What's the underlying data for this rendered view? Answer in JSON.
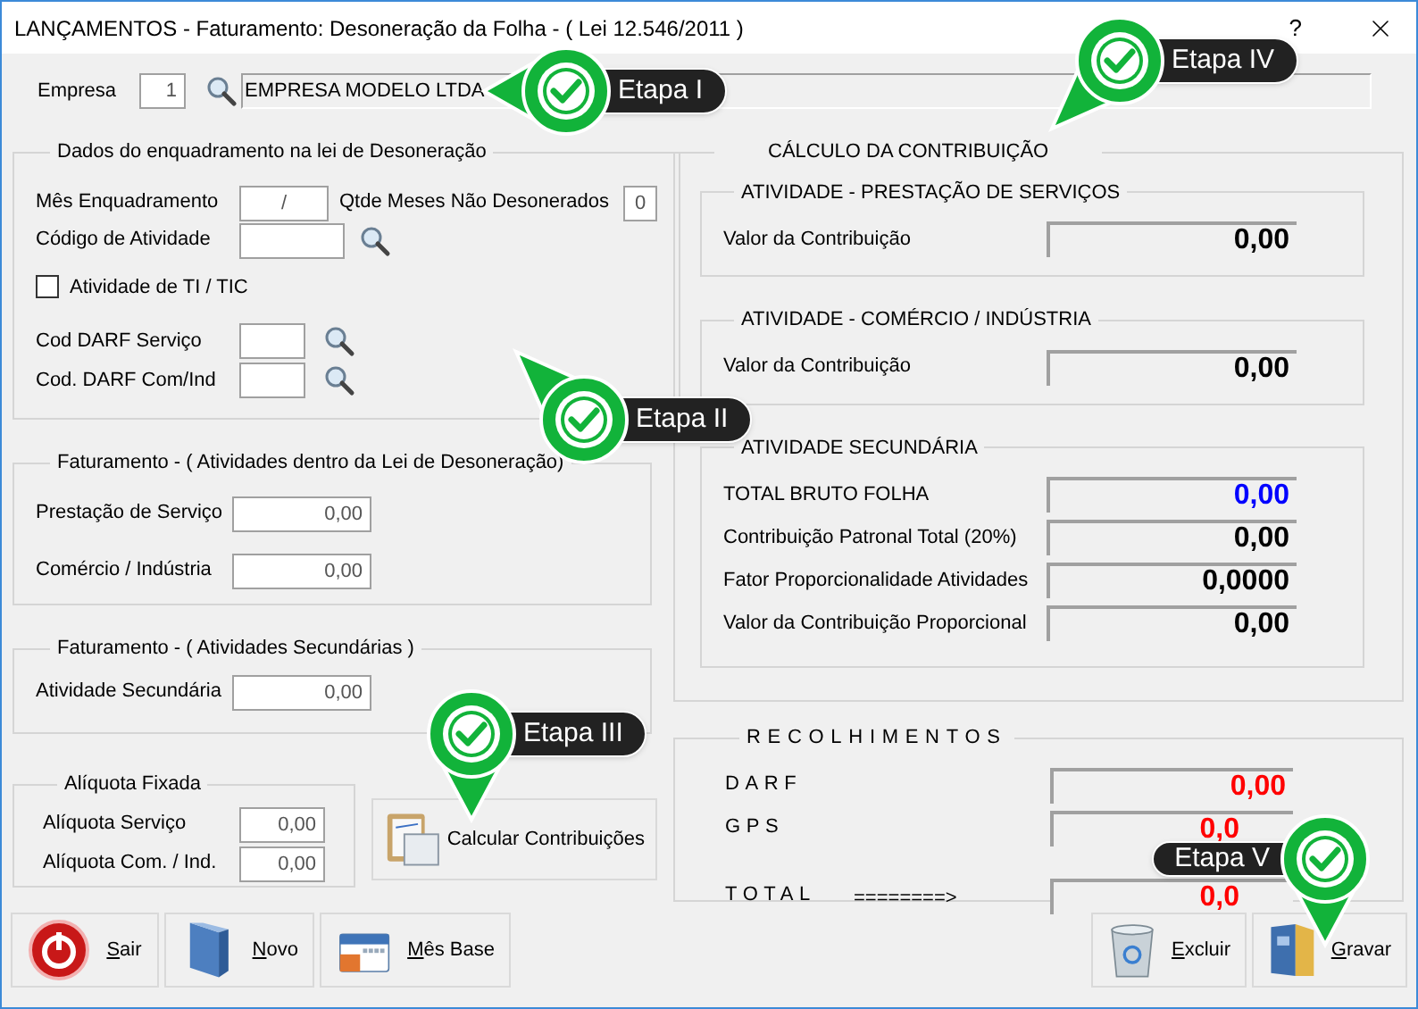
{
  "window": {
    "title": "LANÇAMENTOS - Faturamento: Desoneração da Folha - ( Lei 12.546/2011 )",
    "help": "?"
  },
  "empresa": {
    "label": "Empresa",
    "code": "1",
    "name": "EMPRESA MODELO LTDA"
  },
  "enquadramento": {
    "title": "Dados do enquadramento na lei de Desoneração",
    "mes_label": "Mês Enquadramento",
    "mes_value": "/",
    "qtde_label": "Qtde Meses Não Desonerados",
    "qtde_value": "0",
    "codigo_label": "Código de Atividade",
    "ti": {
      "label": "Atividade de TI / TIC",
      "checked": false
    },
    "darf_servico_label": "Cod DARF Serviço",
    "darf_com_label": "Cod. DARF Com/Ind"
  },
  "faturamento_lei": {
    "title": "Faturamento - ( Atividades dentro da Lei de Desoneração)",
    "rows": [
      {
        "label": "Prestação de Serviço",
        "value": "0,00"
      },
      {
        "label": "Comércio / Indústria",
        "value": "0,00"
      }
    ]
  },
  "faturamento_sec": {
    "title": "Faturamento - ( Atividades Secundárias )",
    "rows": [
      {
        "label": "Atividade Secundária",
        "value": "0,00"
      }
    ]
  },
  "aliquota": {
    "title": "Alíquota Fixada",
    "rows": [
      {
        "label": "Alíquota Serviço",
        "value": "0,00"
      },
      {
        "label": "Alíquota Com. / Ind.",
        "value": "0,00"
      }
    ]
  },
  "calcular_button": "Calcular Contribuições",
  "calculo": {
    "title": "CÁLCULO DA CONTRIBUIÇÃO",
    "groups": [
      {
        "title": "ATIVIDADE - PRESTAÇÃO DE SERVIÇOS",
        "rows": [
          {
            "label": "Valor da Contribuição",
            "value": "0,00",
            "color": "#000000"
          }
        ]
      },
      {
        "title": "ATIVIDADE - COMÉRCIO / INDÚSTRIA",
        "rows": [
          {
            "label": "Valor da Contribuição",
            "value": "0,00",
            "color": "#000000"
          }
        ]
      },
      {
        "title": "ATIVIDADE SECUNDÁRIA",
        "rows": [
          {
            "label": "TOTAL BRUTO FOLHA",
            "value": "0,00",
            "color": "#0000ff"
          },
          {
            "label": "Contribuição Patronal Total (20%)",
            "value": "0,00",
            "color": "#000000"
          },
          {
            "label": "Fator Proporcionalidade Atividades",
            "value": "0,0000",
            "color": "#000000"
          },
          {
            "label": "Valor da Contribuição Proporcional",
            "value": "0,00",
            "color": "#000000"
          }
        ]
      }
    ]
  },
  "recolhimentos": {
    "title": "RECOLHIMENTOS",
    "rows": [
      {
        "label": "DARF",
        "value": "0,00"
      },
      {
        "label": "GPS",
        "value": "0,0"
      },
      {
        "label": "TOTAL",
        "arrow": "========>",
        "value": "0,0"
      }
    ]
  },
  "left_buttons": [
    {
      "label": "Sair",
      "kind": "exit"
    },
    {
      "label": "Novo",
      "kind": "new"
    },
    {
      "label": "Mês Base",
      "kind": "calendar"
    }
  ],
  "right_buttons": [
    {
      "label": "Excluir",
      "kind": "delete"
    },
    {
      "label": "Gravar",
      "kind": "save"
    }
  ],
  "callouts": [
    {
      "label": "Etapa I",
      "kind": "left"
    },
    {
      "label": "Etapa IV",
      "kind": "downleft"
    },
    {
      "label": "Etapa II",
      "kind": "upleft"
    },
    {
      "label": "Etapa III",
      "kind": "down"
    },
    {
      "label": "Etapa V",
      "kind": "downmirrored"
    }
  ]
}
